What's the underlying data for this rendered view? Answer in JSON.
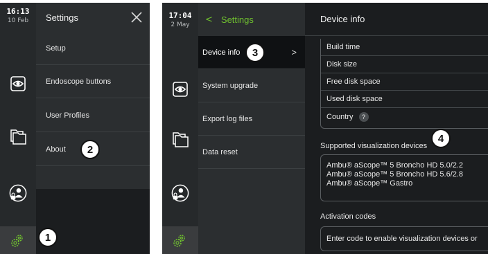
{
  "left": {
    "clock": {
      "time": "16:13",
      "date": "10 Feb"
    },
    "header": {
      "title": "Settings",
      "close_icon": "close-icon"
    },
    "menu": [
      {
        "label": "Setup"
      },
      {
        "label": "Endoscope buttons"
      },
      {
        "label": "User Profiles"
      },
      {
        "label": "About"
      }
    ],
    "callouts": [
      "1",
      "2"
    ]
  },
  "right": {
    "clock": {
      "time": "17:04",
      "date": "2 May"
    },
    "header": {
      "back_label": "Settings",
      "back_glyph": "<",
      "title": "Device info"
    },
    "menu": [
      {
        "label": "Device info",
        "chevron": ">"
      },
      {
        "label": "System upgrade"
      },
      {
        "label": "Export log files"
      },
      {
        "label": "Data reset"
      }
    ],
    "info_rows": [
      {
        "label": "Build time"
      },
      {
        "label": "Disk size"
      },
      {
        "label": "Free disk space"
      },
      {
        "label": "Used disk space"
      },
      {
        "label": "Country",
        "help": "?"
      }
    ],
    "supported": {
      "title": "Supported visualization devices",
      "devices": [
        "Ambu® aScope™ 5 Broncho HD 5.0/2.2",
        "Ambu® aScope™ 5 Broncho HD 5.6/2.8",
        "Ambu® aScope™ Gastro"
      ]
    },
    "activation": {
      "title": "Activation codes",
      "placeholder": "Enter code to enable visualization devices or"
    },
    "callouts": [
      "3",
      "4"
    ]
  },
  "colors": {
    "accent": "#6fbf2f",
    "background": "#1b1d1f",
    "rail": "#26292b",
    "menu": "#2b2e30"
  },
  "icons": [
    "eye-icon",
    "files-icon",
    "user-lock-icon",
    "gear-icon"
  ]
}
